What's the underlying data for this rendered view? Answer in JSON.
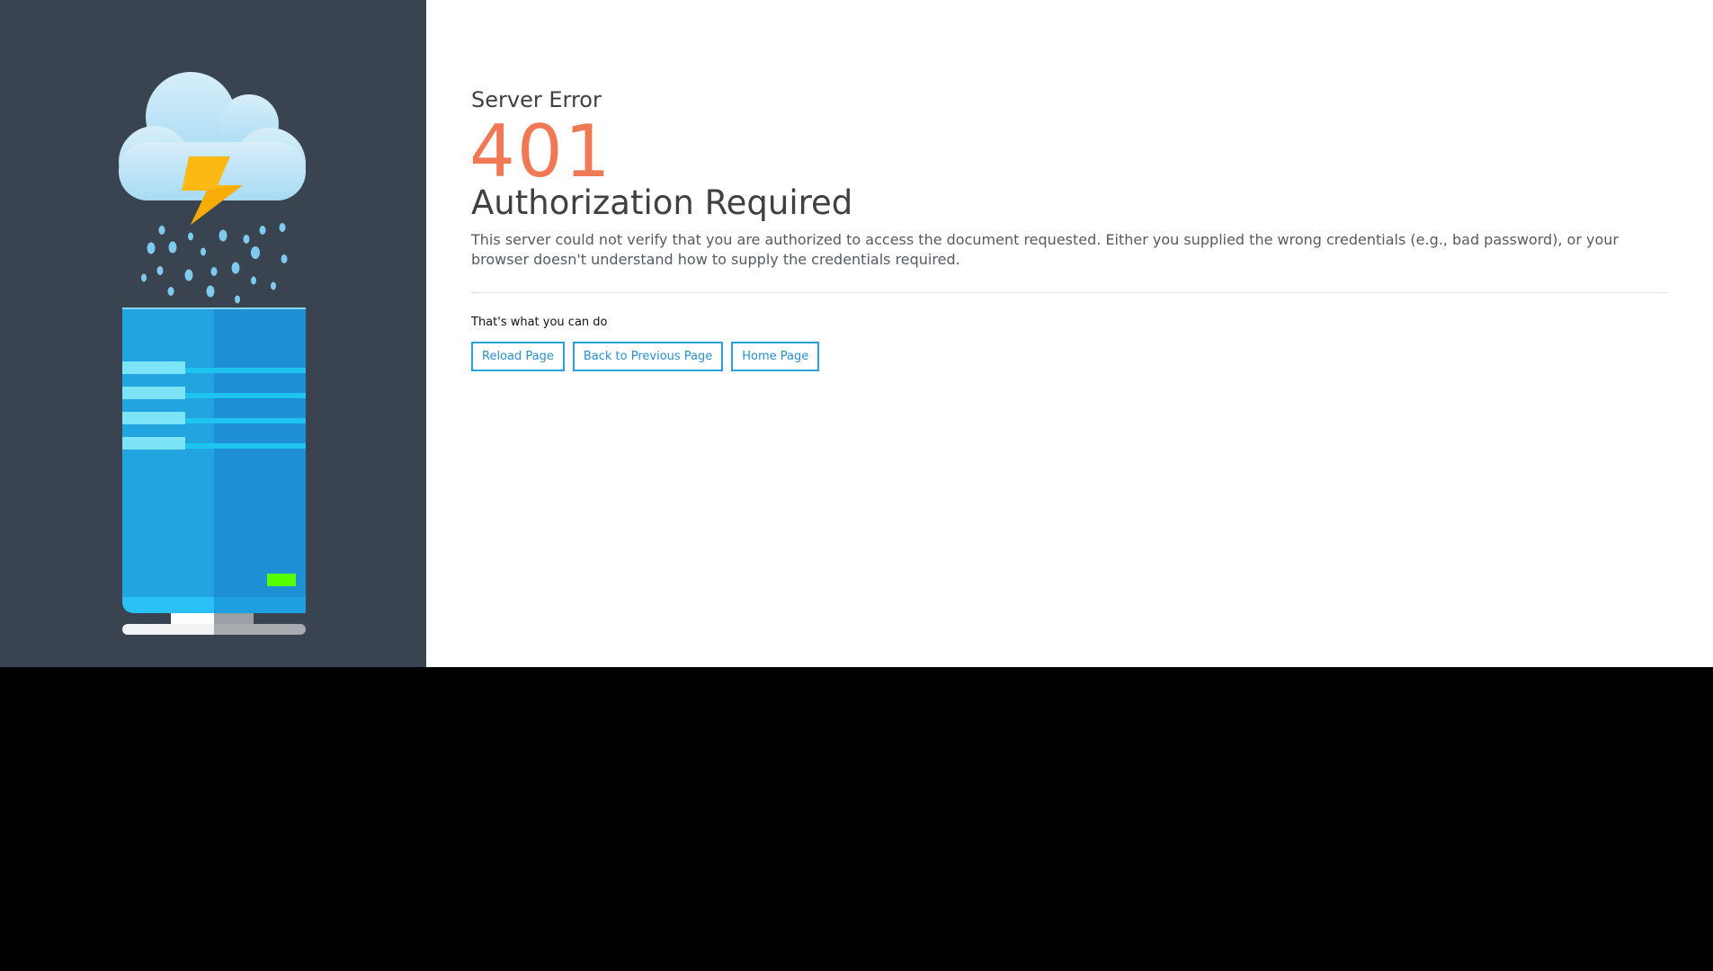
{
  "error": {
    "heading": "Server Error",
    "code": "401",
    "title": "Authorization Required",
    "description": "This server could not verify that you are authorized to access the document requested. Either you supplied the wrong credentials (e.g., bad password), or your browser doesn't understand how to supply the credentials required."
  },
  "actions": {
    "intro": "That's what you can do",
    "reload_label": "Reload Page",
    "back_label": "Back to Previous Page",
    "home_label": "Home Page"
  },
  "colors": {
    "sidebar_bg": "#3a4450",
    "code_color": "#f07855",
    "button_accent": "#2ca0d9",
    "bottom_area": "#000000"
  },
  "icons": {
    "illustration": "storm-cloud-server-icon"
  }
}
